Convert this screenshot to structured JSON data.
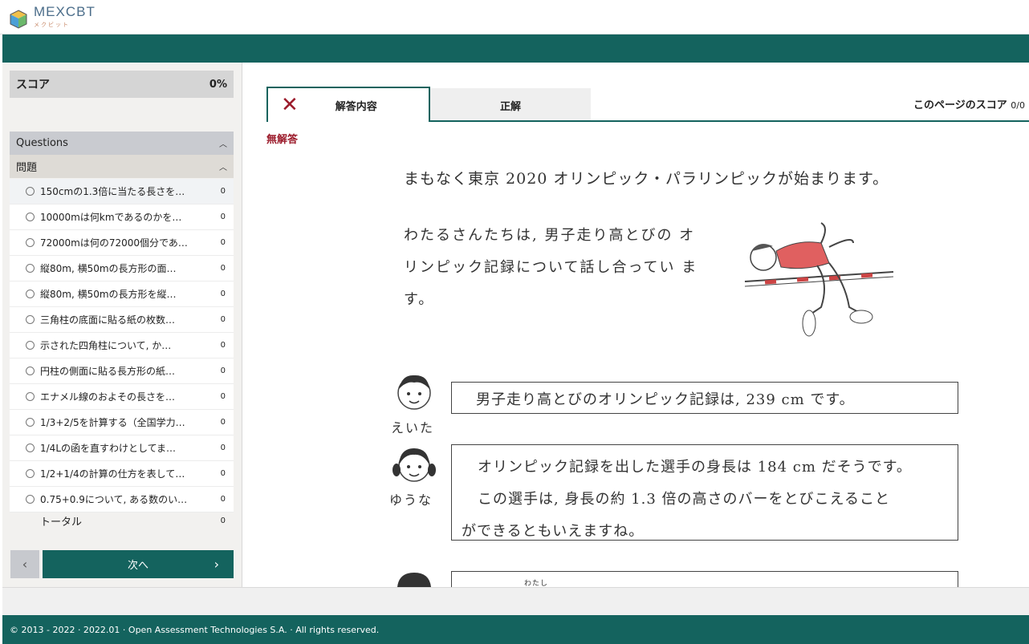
{
  "app": {
    "logo_text": "MEXCBT",
    "logo_sub": "メクビット"
  },
  "sidebar": {
    "score_label": "スコア",
    "score_value": "0%",
    "questions_label": "Questions",
    "section_label": "問題",
    "items": [
      {
        "label": "150cmの1.3倍に当たる長さを…",
        "score": "0"
      },
      {
        "label": "10000mは何kmであるのかを…",
        "score": "0"
      },
      {
        "label": "72000mは何の72000個分であ…",
        "score": "0"
      },
      {
        "label": "縦80m, 横50mの長方形の面…",
        "score": "0"
      },
      {
        "label": "縦80m, 横50mの長方形を縦…",
        "score": "0"
      },
      {
        "label": "三角柱の底面に貼る紙の枚数…",
        "score": "0"
      },
      {
        "label": "示された四角柱について, か…",
        "score": "0"
      },
      {
        "label": "円柱の側面に貼る長方形の紙…",
        "score": "0"
      },
      {
        "label": "エナメル線のおよその長さを…",
        "score": "0"
      },
      {
        "label": "1/3+2/5を計算する（全国学力…",
        "score": "0"
      },
      {
        "label": "1/4Lの函を直すわけとしてま…",
        "score": "0"
      },
      {
        "label": "1/2+1/4の計算の仕方を表して…",
        "score": "0"
      },
      {
        "label": "0.75+0.9について, ある数のい…",
        "score": "0"
      }
    ],
    "total_label": "トータル",
    "total_score": "0",
    "prev_icon": "‹",
    "next_label": "次へ",
    "next_icon": "›"
  },
  "main": {
    "tab_answer": "解答内容",
    "tab_correct": "正解",
    "page_score_label": "このページのスコア",
    "page_score_value": "0/0",
    "no_answer": "無解答",
    "intro": "まもなく東京 2020 オリンピック・パラリンピックが始まります。",
    "para": "わたるさんたちは, 男子走り高とびの オリンピック記録について話し合ってい ます。",
    "bubble1": "男子走り高とびのオリンピック記録は, 239 cm です。",
    "bubble2_line1": "オリンピック記録を出した選手の身長は 184 cm だそうです。",
    "bubble2_line2": "この選手は, 身長の約 1.3 倍の高さのバーをとびこえること",
    "bubble2_line3": "ができるともいえますね。",
    "bubble3_ruby": "わたし",
    "name1": "えいた",
    "name2": "ゆうな"
  },
  "footer": {
    "copyright": "© 2013 - 2022 · 2022.01 · Open Assessment Technologies S.A. · All rights reserved."
  }
}
